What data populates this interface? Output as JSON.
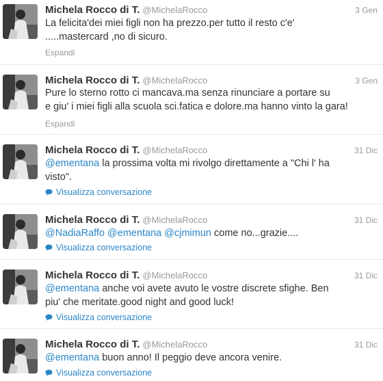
{
  "tweets": [
    {
      "name": "Michela Rocco di T.",
      "handle": "@MichelaRocco",
      "time": "3 Gen",
      "line1": "La felicita'dei miei figli non ha prezzo.per tutto il resto c'e'",
      "line2": ".....mastercard ,no di sicuro.",
      "action": "Espandi"
    },
    {
      "name": "Michela Rocco di T.",
      "handle": "@MichelaRocco",
      "time": "3 Gen",
      "line1": "Pure lo sterno rotto ci mancava.ma senza rinunciare a portare su",
      "line2": "e giu' i miei figli alla scuola sci.fatica e dolore.ma hanno vinto la gara!",
      "action": "Espandi"
    },
    {
      "name": "Michela Rocco di T.",
      "handle": "@MichelaRocco",
      "time": "31 Dic",
      "mention1": "@ementana",
      "line1": " la prossima volta mi rivolgo direttamente a \"Chi l' ha",
      "line2": "visto\".",
      "action": "Visualizza conversazione"
    },
    {
      "name": "Michela Rocco di T.",
      "handle": "@MichelaRocco",
      "time": "31 Dic",
      "mention1": "@NadiaRaffo",
      "mention2": "@ementana",
      "mention3": "@cjmimun",
      "line1": " come no...grazie....",
      "action": "Visualizza conversazione"
    },
    {
      "name": "Michela Rocco di T.",
      "handle": "@MichelaRocco",
      "time": "31 Dic",
      "mention1": "@ementana",
      "line1": " anche voi avete avuto le vostre discrete sfighe. Ben",
      "line2": "piu' che meritate.good night and good luck!",
      "action": "Visualizza conversazione"
    },
    {
      "name": "Michela Rocco di T.",
      "handle": "@MichelaRocco",
      "time": "31 Dic",
      "mention1": "@ementana",
      "line1": " buon anno! Il peggio deve ancora venire.",
      "action": "Visualizza conversazione"
    }
  ],
  "icons": {
    "avatar": "user-photo",
    "conversation": "speech-bubble-icon"
  },
  "colors": {
    "link": "#2a85c7",
    "meta": "#999999",
    "text": "#333333"
  }
}
